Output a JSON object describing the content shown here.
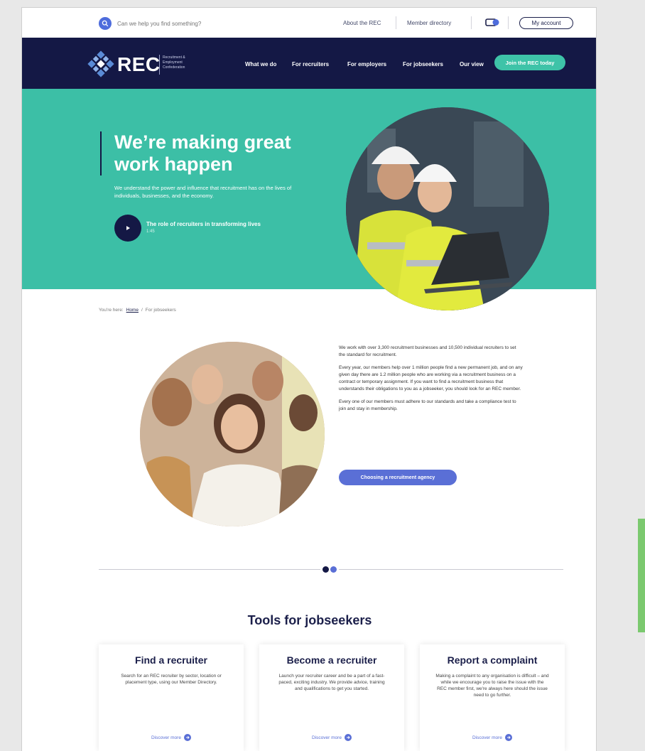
{
  "utility": {
    "search_placeholder": "Can we help you find something?",
    "about_link": "About the REC",
    "directory_link": "Member directory",
    "account_button": "My account"
  },
  "nav": {
    "logo_text": "REC",
    "logo_sub": "Recruitment & Employment Confederation",
    "items": [
      "What we do",
      "For recruiters",
      "For employers",
      "For jobseekers",
      "Our view"
    ],
    "join_button": "Join the REC today"
  },
  "hero": {
    "title": "We’re making great work happen",
    "text": "We understand the power and influence that recruitment has on the lives of individuals, businesses, and the economy.",
    "video_title": "The role of recruiters in transforming lives",
    "video_duration": "1:45"
  },
  "breadcrumb": {
    "prefix": "You're here:",
    "home": "Home",
    "separator": "/",
    "current": "For jobseekers"
  },
  "intro": {
    "paragraphs": [
      "We work with over 3,300 recruitment businesses and 10,500 individual recruiters to set the standard for recruitment.",
      "Every year, our members help over 1 million people find a new permanent job, and on any given day there are 1.2 million people who are working via a recruitment business on a contract or temporary assignment. If you want to find a recruitment business that understands their obligations to you as a jobseeker, you should look for an REC member.",
      "Every one of our members must adhere to our standards and take a compliance test to join and stay in membership."
    ],
    "button": "Choosing a recruitment agency"
  },
  "tools": {
    "title": "Tools for jobseekers",
    "cards": [
      {
        "title": "Find a recruiter",
        "text": "Search for an REC recruiter by sector, location or placement type, using our Member Directory.",
        "link": "Discover more"
      },
      {
        "title": "Become a recruiter",
        "text": "Launch your recruiter career and be a part of a fast-paced, exciting industry. We provide advice, training and qualifications to get you started.",
        "link": "Discover more"
      },
      {
        "title": "Report a complaint",
        "text": "Making a complaint to any organisation is difficult – and while we encourage you to raise the issue with the REC member first, we're always here should the issue need to go further.",
        "link": "Discover more"
      }
    ]
  },
  "colors": {
    "navy": "#141845",
    "teal": "#3cbfa6",
    "accent_blue": "#5a6fd6"
  }
}
